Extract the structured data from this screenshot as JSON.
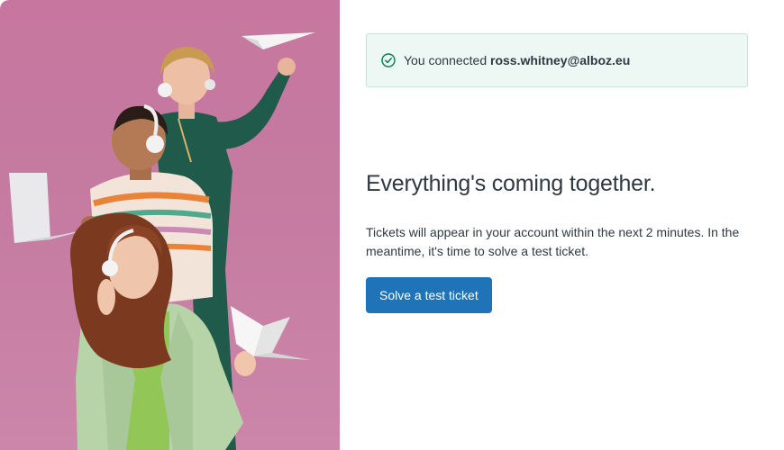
{
  "notice": {
    "prefix": "You connected ",
    "email": "ross.whitney@alboz.eu",
    "icon": "check-circle-icon",
    "success_color": "#038153"
  },
  "main": {
    "title": "Everything's coming together.",
    "body": "Tickets will appear in your account within the next 2 minutes. In the meantime, it's time to solve a test ticket.",
    "cta_label": "Solve a test ticket"
  },
  "colors": {
    "hero_background": "#c7779f",
    "primary": "#1f73b7",
    "text": "#2f3941",
    "notice_background": "#edf7f4"
  }
}
